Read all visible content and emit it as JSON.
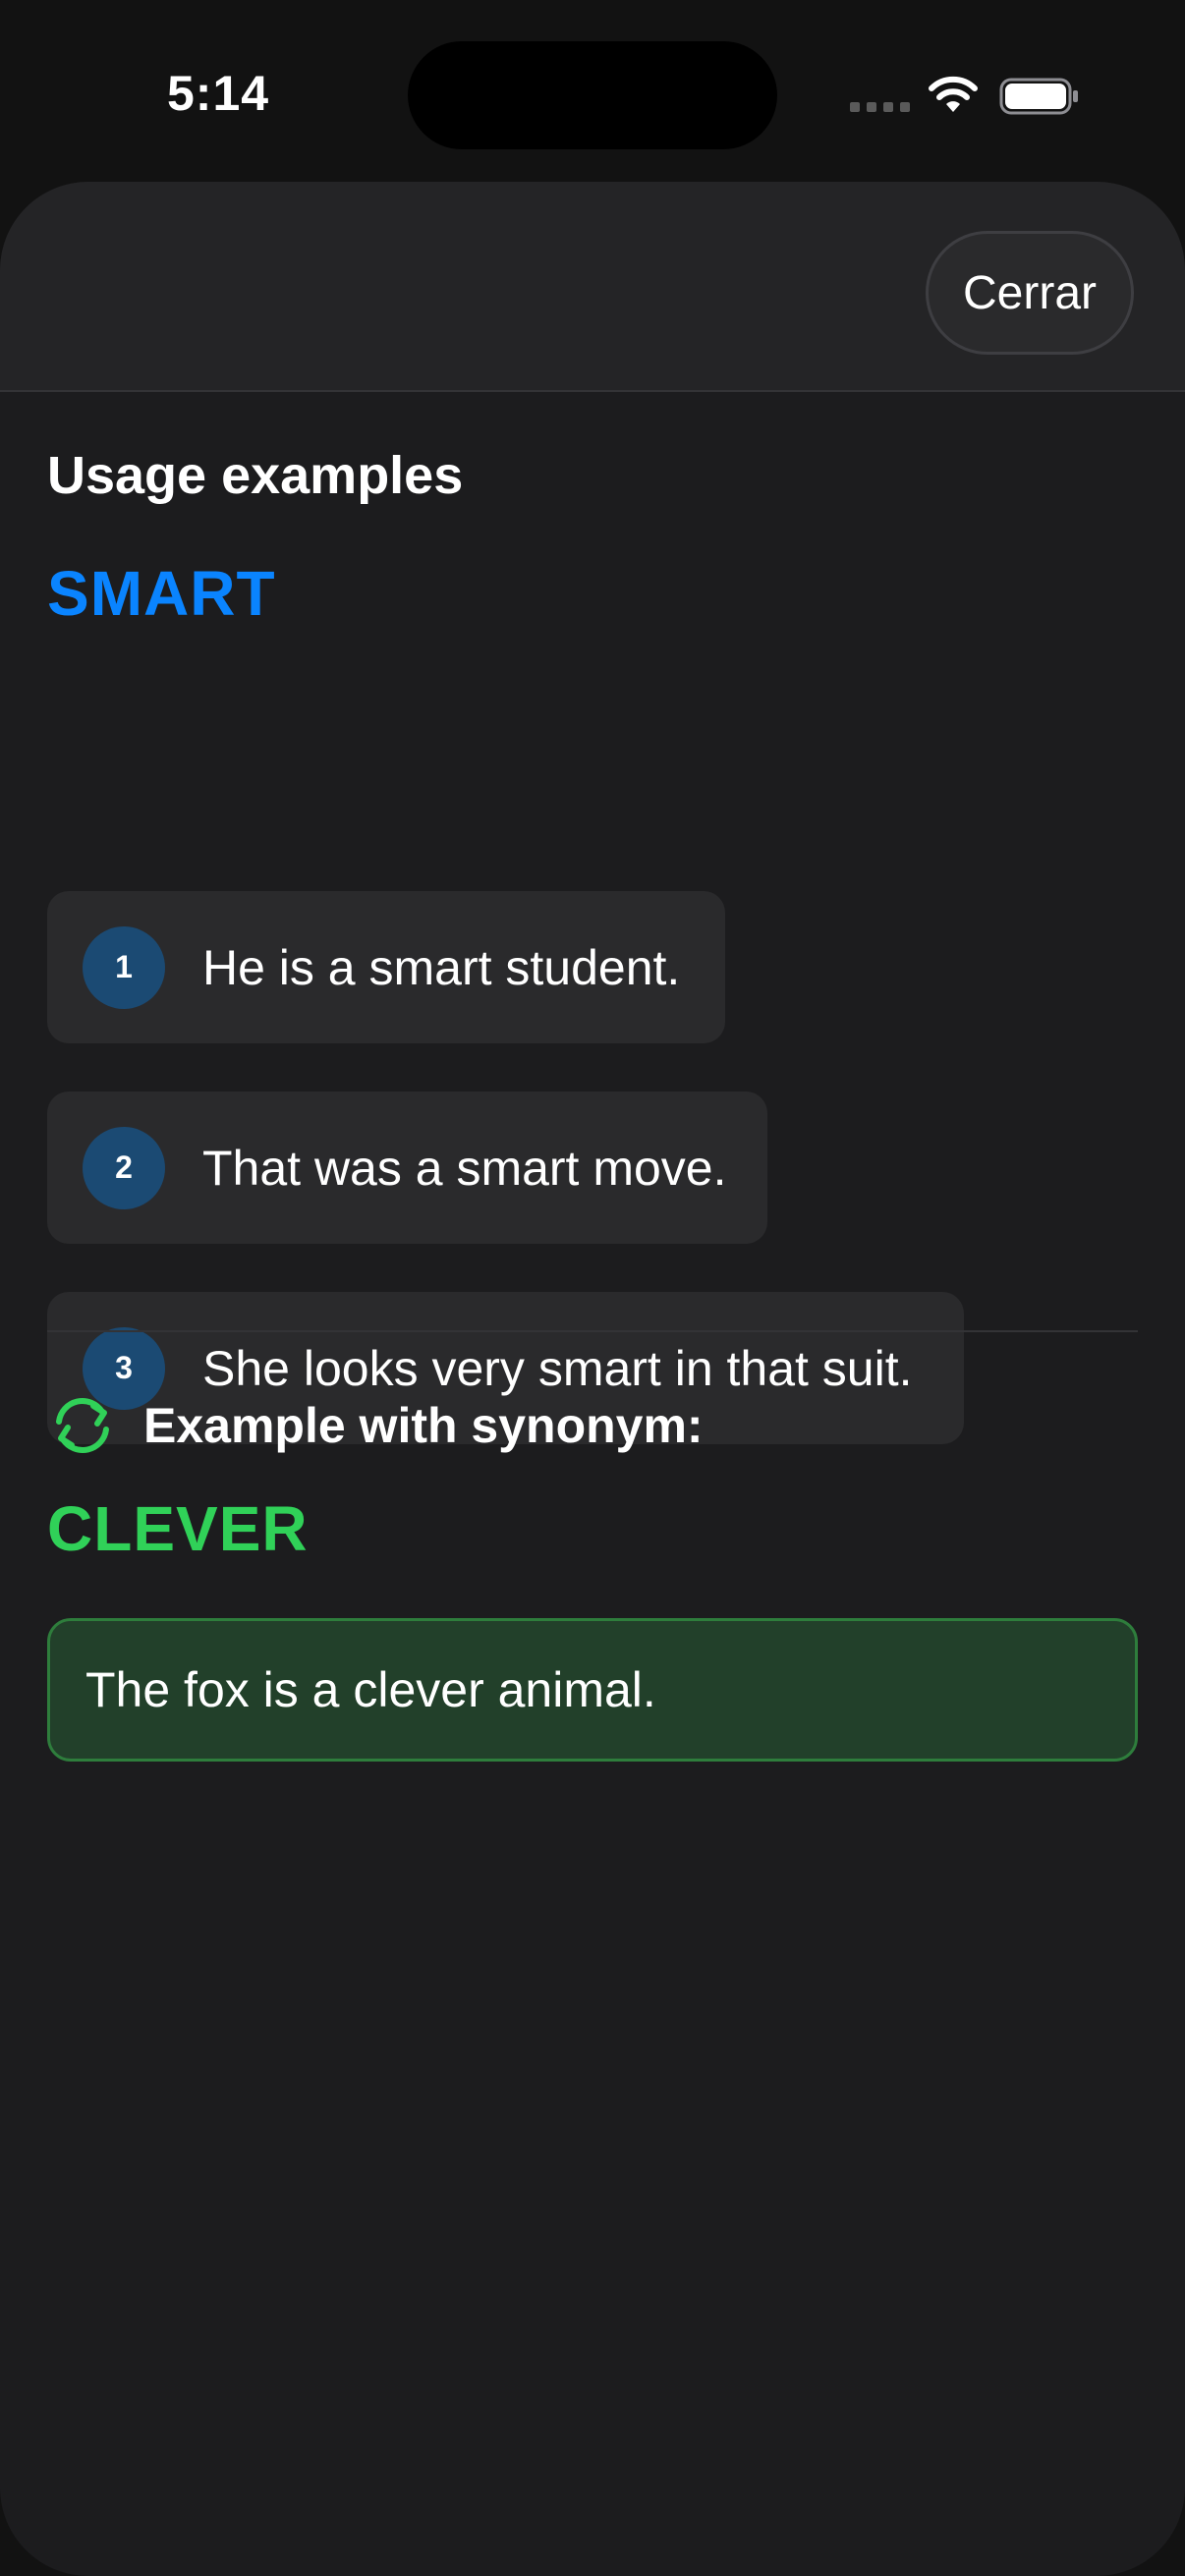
{
  "status_bar": {
    "time": "5:14"
  },
  "sheet": {
    "close_label": "Cerrar",
    "section_title": "Usage examples",
    "word": "SMART",
    "examples": [
      {
        "number": "1",
        "text": "He is a smart student."
      },
      {
        "number": "2",
        "text": "That was a smart move."
      },
      {
        "number": "3",
        "text": "She looks very smart in that suit."
      }
    ],
    "synonym_label": "Example with synonym:",
    "synonym_word": "CLEVER",
    "synonym_example": "The fox is a clever animal."
  },
  "colors": {
    "background": "#1c1c1e",
    "accent_blue": "#0a84ff",
    "accent_green": "#30d158",
    "card": "#2a2a2c",
    "badge": "#1b4a73",
    "synonym_card": "#22402a"
  },
  "icons": {
    "wifi": "wifi-icon",
    "battery": "battery-icon",
    "sync": "sync-icon"
  }
}
